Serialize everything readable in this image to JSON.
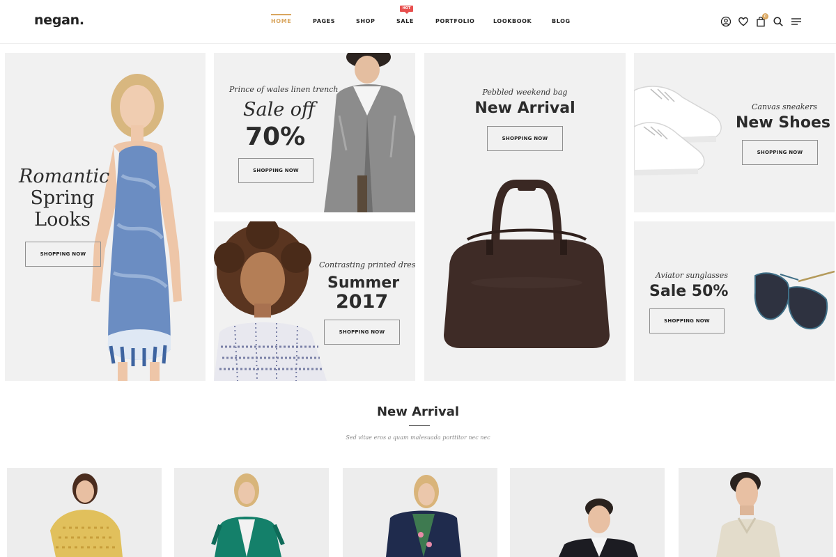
{
  "header": {
    "logo": "negan.",
    "nav": [
      {
        "label": "HOME",
        "active": true
      },
      {
        "label": "PAGES",
        "active": false
      },
      {
        "label": "SHOP",
        "active": false
      },
      {
        "label": "SALE",
        "active": false,
        "badge": "HOT"
      },
      {
        "label": "PORTFOLIO",
        "active": false
      },
      {
        "label": "LOOKBOOK",
        "active": false
      },
      {
        "label": "BLOG",
        "active": false
      }
    ],
    "icons": [
      "user-icon",
      "heart-icon",
      "cart-icon",
      "search-icon",
      "menu-icon"
    ],
    "cart_count": "0",
    "accent_color": "#d9a65f",
    "badge_color": "#e8504f"
  },
  "banners": {
    "romantic": {
      "title_line1": "Romantic",
      "title_line2": "Spring",
      "title_line3": "Looks",
      "button": "SHOPPING NOW"
    },
    "trench": {
      "script": "Prince of wales linen trench",
      "line1": "Sale off",
      "line2": "70%",
      "button": "SHOPPING NOW"
    },
    "bag": {
      "script": "Pebbled weekend bag",
      "headline": "New Arrival",
      "button": "SHOPPING NOW"
    },
    "shoes": {
      "script": "Canvas sneakers",
      "headline": "New Shoes",
      "button": "SHOPPING NOW"
    },
    "summer": {
      "script": "Contrasting printed dress",
      "line1": "Summer",
      "line2": "2017",
      "button": "SHOPPING NOW"
    },
    "sunglasses": {
      "script": "Aviator sunglasses",
      "headline": "Sale 50%",
      "button": "SHOPPING NOW"
    }
  },
  "new_arrival": {
    "title": "New Arrival",
    "subtitle": "Sed vitae eros a quam malesuada porttitor nec nec"
  },
  "products": [
    {
      "name": "product-yellow-dress"
    },
    {
      "name": "product-green-jacket"
    },
    {
      "name": "product-navy-blazer"
    },
    {
      "name": "product-black-suit"
    },
    {
      "name": "product-beige-shirt"
    }
  ]
}
